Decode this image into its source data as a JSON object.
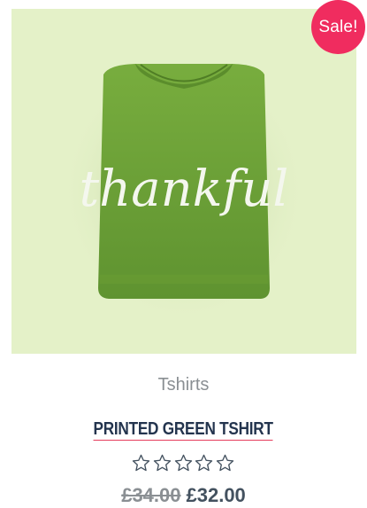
{
  "product": {
    "badge": "Sale!",
    "shirt_print_text": "thankful",
    "category": "Tshirts",
    "title": "PRINTED GREEN TSHIRT",
    "rating": {
      "value": 0,
      "max": 5
    },
    "old_price": "£34.00",
    "new_price": "£32.00"
  },
  "colors": {
    "image_background": "#e4f1c8",
    "shirt": "#6ea336",
    "badge": "#f02c5f",
    "title": "#23344e",
    "title_underline": "#e53d5c",
    "muted_text": "#8a8f93",
    "price": "#43515f"
  },
  "icons": {
    "rating_star": "star-outline-icon"
  }
}
